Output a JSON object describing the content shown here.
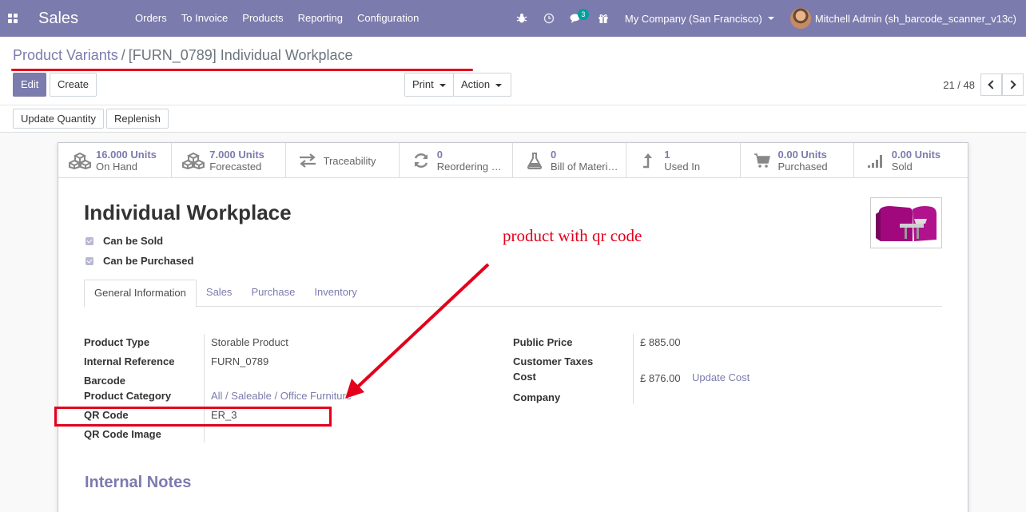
{
  "navbar": {
    "app_name": "Sales",
    "menu": [
      "Orders",
      "To Invoice",
      "Products",
      "Reporting",
      "Configuration"
    ],
    "chat_badge": "3",
    "company": "My Company (San Francisco)",
    "user": "Mitchell Admin (sh_barcode_scanner_v13c)"
  },
  "breadcrumb": {
    "parent": "Product Variants",
    "separator": "/",
    "current": "[FURN_0789] Individual Workplace"
  },
  "toolbar": {
    "edit": "Edit",
    "create": "Create",
    "print": "Print",
    "action": "Action",
    "pager": "21 / 48",
    "update_quantity": "Update Quantity",
    "replenish": "Replenish"
  },
  "smart_buttons": [
    {
      "value": "16.000 Units",
      "label": "On Hand",
      "icon": "cubes-icon"
    },
    {
      "value": "7.000 Units",
      "label": "Forecasted",
      "icon": "cubes-icon"
    },
    {
      "value": "",
      "label": "Traceability",
      "icon": "exchange-icon"
    },
    {
      "value": "0",
      "label": "Reordering Rules",
      "icon": "refresh-icon"
    },
    {
      "value": "0",
      "label": "Bill of Materials",
      "icon": "flask-icon"
    },
    {
      "value": "1",
      "label": "Used In",
      "icon": "level-up-icon"
    },
    {
      "value": "0.00 Units",
      "label": "Purchased",
      "icon": "cart-icon"
    },
    {
      "value": "0.00 Units",
      "label": "Sold",
      "icon": "signal-icon"
    }
  ],
  "product": {
    "name": "Individual Workplace",
    "can_be_sold": "Can be Sold",
    "can_be_purchased": "Can be Purchased"
  },
  "tabs": [
    "General Information",
    "Sales",
    "Purchase",
    "Inventory"
  ],
  "fields_left": [
    {
      "label": "Product Type",
      "value": "Storable Product"
    },
    {
      "label": "Internal Reference",
      "value": "FURN_0789"
    },
    {
      "label": "Barcode",
      "value": ""
    },
    {
      "label": "Product Category",
      "value": "All / Saleable / Office Furniture"
    },
    {
      "label": "QR Code",
      "value": "ER_3"
    },
    {
      "label": "QR Code Image",
      "value": ""
    }
  ],
  "fields_right": [
    {
      "label": "Public Price",
      "value": "£ 885.00"
    },
    {
      "label": "Customer Taxes",
      "value": ""
    },
    {
      "label": "Cost",
      "value": "£ 876.00"
    },
    {
      "label": "Company",
      "value": ""
    }
  ],
  "update_cost": "Update Cost",
  "notes_title": "Internal Notes",
  "annotation": "product with qr code",
  "colors": {
    "primary": "#7c7bad",
    "annotation": "#e3001b"
  }
}
